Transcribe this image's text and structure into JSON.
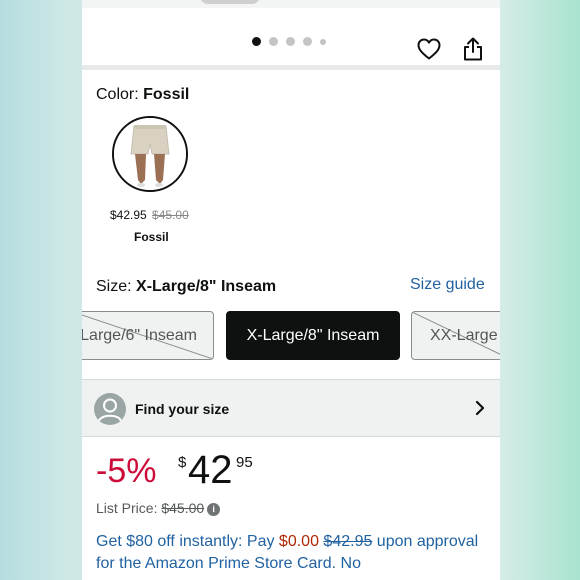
{
  "carousel": {
    "dots_count": 5,
    "active_index": 0
  },
  "color": {
    "label": "Color: ",
    "value": "Fossil"
  },
  "swatch": {
    "price": "$42.95",
    "list_price": "$45.00",
    "name": "Fossil"
  },
  "size": {
    "label": "Size: ",
    "value": "X-Large/8\" Inseam",
    "guide_link": "Size guide",
    "options": [
      {
        "label": "Large/6\" Inseam",
        "status": "unavailable"
      },
      {
        "label": "X-Large/8\" Inseam",
        "status": "selected"
      },
      {
        "label": "XX-Large",
        "status": "unavailable"
      }
    ]
  },
  "find_size": {
    "label": "Find your size"
  },
  "price": {
    "discount": "-5%",
    "currency": "$",
    "whole": "42",
    "fraction": "95",
    "list_label": "List Price: ",
    "list_value": "$45.00",
    "info_icon": "i"
  },
  "promo": {
    "part1": "Get $80 off instantly: Pay ",
    "pay_amount": "$0.00",
    "old_amount": "$42.95",
    "part2": " upon approval for the Amazon Prime Store Card. No"
  },
  "colors": {
    "accent_link": "#2162a1",
    "discount": "#cc0c39",
    "deal": "#b12704",
    "selected_bg": "#0f1111"
  }
}
